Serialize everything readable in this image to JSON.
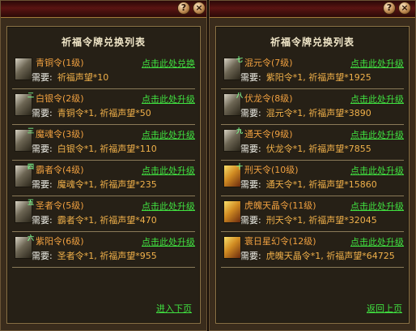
{
  "left_panel": {
    "help_icon": "?",
    "close_icon": "×",
    "heading": "祈福令牌兑换列表",
    "items": [
      {
        "name": "青铜令(1级)",
        "need_label": "需要:",
        "need": "祈福声望*10",
        "action": "点击此处兑换",
        "icon": "bronze-token-icon"
      },
      {
        "name": "白银令(2级)",
        "need_label": "需要:",
        "need": "青铜令*1, 祈福声望*50",
        "action": "点击此处升级",
        "icon": "silver-token-icon"
      },
      {
        "name": "魔魂令(3级)",
        "need_label": "需要:",
        "need": "白银令*1, 祈福声望*110",
        "action": "点击此处升级",
        "icon": "demon-soul-token-icon"
      },
      {
        "name": "霸者令(4级)",
        "need_label": "需要:",
        "need": "魔魂令*1, 祈福声望*235",
        "action": "点击此处升级",
        "icon": "overlord-token-icon"
      },
      {
        "name": "圣者令(5级)",
        "need_label": "需要:",
        "need": "霸者令*1, 祈福声望*470",
        "action": "点击此处升级",
        "icon": "saint-token-icon"
      },
      {
        "name": "紫阳令(6级)",
        "need_label": "需要:",
        "need": "圣者令*1, 祈福声望*955",
        "action": "点击此处升级",
        "icon": "purple-sun-token-icon"
      }
    ],
    "page_link": "进入下页"
  },
  "right_panel": {
    "help_icon": "?",
    "close_icon": "×",
    "heading": "祈福令牌兑换列表",
    "items": [
      {
        "name": "混元令(7级)",
        "need_label": "需要:",
        "need": "紫阳令*1, 祈福声望*1925",
        "action": "点击此处升级",
        "icon": "chaos-origin-token-icon"
      },
      {
        "name": "伏龙令(8级)",
        "need_label": "需要:",
        "need": "混元令*1, 祈福声望*3890",
        "action": "点击此处升级",
        "icon": "dragon-subduer-token-icon"
      },
      {
        "name": "通天令(9级)",
        "need_label": "需要:",
        "need": "伏龙令*1, 祈福声望*7855",
        "action": "点击此处升级",
        "icon": "heaven-reach-token-icon"
      },
      {
        "name": "刑天令(10级)",
        "need_label": "需要:",
        "need": "通天令*1, 祈福声望*15860",
        "action": "点击此处升级",
        "icon": "xingtian-token-icon"
      },
      {
        "name": "虎魄天晶令(11级)",
        "need_label": "需要:",
        "need": "刑天令*1, 祈福声望*32045",
        "action": "点击此处升级",
        "icon": "tiger-crystal-token-icon"
      },
      {
        "name": "寰日星幻令(12级)",
        "need_label": "需要:",
        "need": "虎魄天晶令*1, 祈福声望*64725",
        "action": "点击此处升级",
        "icon": "sun-star-token-icon"
      }
    ],
    "page_link": "返回上页"
  }
}
